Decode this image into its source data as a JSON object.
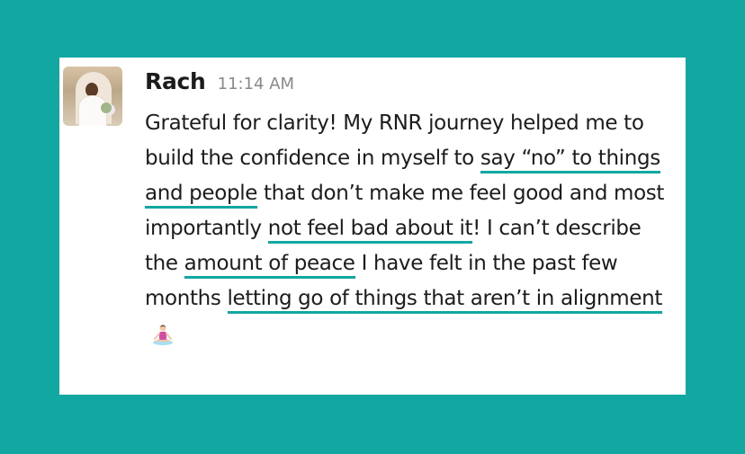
{
  "message": {
    "author": "Rach",
    "timestamp": "11:14 AM",
    "text_parts": [
      "Grateful for clarity! My RNR journey helped me to build the confidence in myself to ",
      "say “no” to things and people",
      " that don’t make me feel good and most importantly ",
      "not feel bad about it",
      "! I can’t describe the ",
      "amount of peace",
      " I have felt in the past few months ",
      "letting go of things that aren’t in alignment",
      " "
    ],
    "emoji": "person-in-lotus-position-icon"
  },
  "colors": {
    "background": "#13a7a1",
    "card": "#ffffff",
    "text": "#1d1c1d",
    "timestamp": "#898989",
    "underline": "#13a7a1"
  }
}
